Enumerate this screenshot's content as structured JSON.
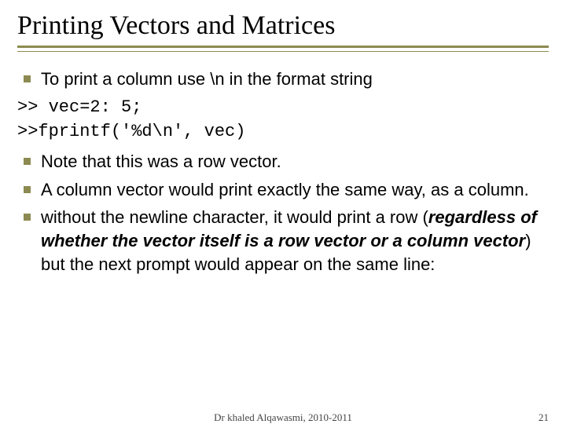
{
  "title": "Printing Vectors and Matrices",
  "bullets_top": [
    "To print a column use \\n in the format string"
  ],
  "code_lines": [
    ">> vec=2: 5;",
    ">>fprintf('%d\\n', vec)"
  ],
  "bullets_bottom": [
    {
      "text": "Note that this was a row vector."
    },
    {
      "text": "A column vector would print exactly the same way, as a column."
    },
    {
      "prefix": " without the newline character, it would print a row (",
      "emph": "regardless of whether the vector itself is a row vector or a column vector",
      "suffix": ") but the next prompt would appear on the same line:"
    }
  ],
  "footer": {
    "author": "Dr khaled Alqawasmi, 2010-2011",
    "page": "21"
  }
}
